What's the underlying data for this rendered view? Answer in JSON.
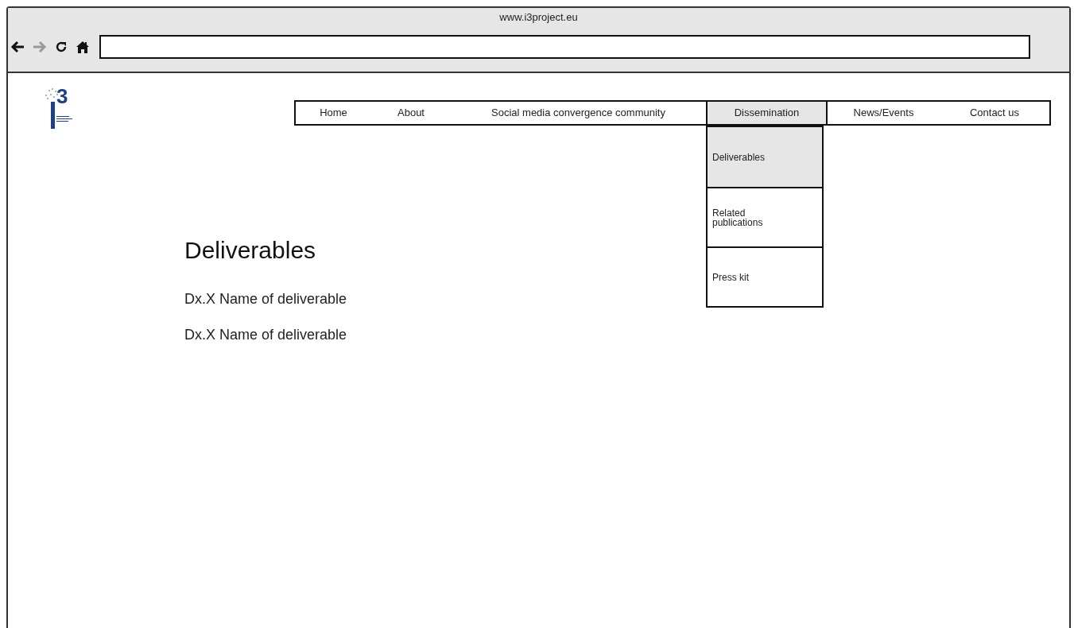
{
  "window": {
    "title": "www.i3project.eu"
  },
  "logo": {
    "mark": "3"
  },
  "nav": [
    {
      "label": "Home",
      "selected": false,
      "kind": "link"
    },
    {
      "label": "About",
      "selected": false,
      "kind": "link"
    },
    {
      "label": "Social media convergence community",
      "selected": false,
      "kind": "link"
    },
    {
      "label": "Dissemination",
      "selected": true,
      "kind": "menu",
      "children": [
        {
          "label": "Deliverables",
          "selected": true
        },
        {
          "label": "Related publications",
          "selected": false
        },
        {
          "label": "Press kit",
          "selected": false
        }
      ]
    },
    {
      "label": "News/Events",
      "selected": false,
      "kind": "link"
    },
    {
      "label": "Contact us",
      "selected": false,
      "kind": "link"
    }
  ],
  "page": {
    "heading": "Deliverables",
    "items": [
      "Dx.X Name of deliverable",
      "Dx.X Name of deliverable"
    ]
  }
}
